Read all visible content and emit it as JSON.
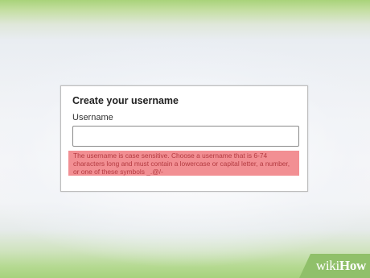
{
  "card": {
    "title": "Create your username",
    "field_label": "Username",
    "input_value": "",
    "input_placeholder": "",
    "help_text": "The username is case sensitive. Choose a username that is 6-74 characters long and must contain a lowercase or capital letter, a number, or one of these symbols _.@/-"
  },
  "watermark": {
    "part1": "wiki",
    "part2": "How"
  },
  "colors": {
    "help_background": "#f28f93",
    "help_text": "#b33a40",
    "watermark_band": "#90c06a"
  }
}
